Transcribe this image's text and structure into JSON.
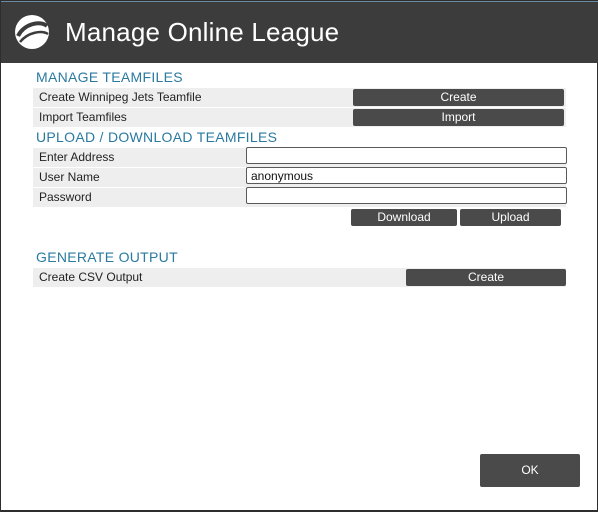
{
  "dialog": {
    "title": "Manage Online League",
    "logo_icon": "hockey-puck-icon",
    "titlebar_color": "#3c3c3c",
    "accent_color": "#2a7aa0"
  },
  "manage_teamfiles": {
    "heading": "MANAGE TEAMFILES",
    "create_label": "Create Winnipeg Jets Teamfile",
    "create_button": "Create",
    "import_label": "Import Teamfiles",
    "import_button": "Import"
  },
  "upload_download": {
    "heading": "UPLOAD / DOWNLOAD TEAMFILES",
    "address_label": "Enter Address",
    "address_value": "",
    "username_label": "User Name",
    "username_value": "anonymous",
    "password_label": "Password",
    "password_value": "",
    "download_button": "Download",
    "upload_button": "Upload"
  },
  "generate_output": {
    "heading": "GENERATE OUTPUT",
    "csv_label": "Create CSV Output",
    "csv_button": "Create"
  },
  "footer": {
    "ok_button": "OK"
  }
}
